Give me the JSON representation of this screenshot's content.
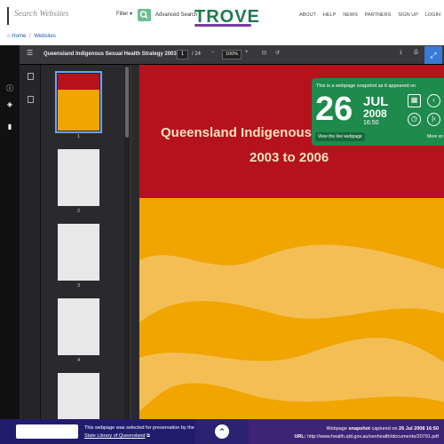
{
  "header": {
    "search_placeholder": "Search Websites",
    "filter_label": "Filter ▾",
    "advanced_search": "Advanced Search",
    "logo": "TROVE",
    "nav": [
      "ABOUT",
      "HELP",
      "NEWS",
      "PARTNERS",
      "SIGN UP",
      "LOGIN"
    ]
  },
  "breadcrumb": {
    "home": "Home",
    "separator": "/",
    "current": "Websites"
  },
  "viewer": {
    "doc_title": "Queensland Indigenous Sexual Health Strategy 2003 ...",
    "page_current": "1",
    "page_total": "/ 24",
    "zoom": "100%",
    "thumbnails": [
      {
        "label": "1"
      },
      {
        "label": "2"
      },
      {
        "label": "3"
      },
      {
        "label": "4"
      }
    ]
  },
  "cover": {
    "title": "Queensland Indigenous Sexu",
    "subtitle": "2003 to 2006"
  },
  "snapshot": {
    "heading": "This is a webpage snapshot as it appeared on",
    "day": "26",
    "month": "JUL",
    "year": "2008",
    "time": "16:50",
    "live_label": "View the live webpage",
    "more_label": "More sn"
  },
  "footer": {
    "selected_text": "This webpage was selected for preservation by the",
    "library_link": "State Library of Queensland",
    "snapshot_prefix": "Webpage",
    "snapshot_bold": "snapshot",
    "snapshot_mid": "captured on",
    "snapshot_date": "26 Jul 2008 16:50",
    "url_label": "URL:",
    "url": "http://www.health.qld.gov.au/sexhealth/documents/20791.pdf"
  },
  "colors": {
    "brand_green": "#1e8a4c",
    "cover_red": "#b5121b",
    "cover_orange": "#f0a500",
    "footer_blue": "#221c6e"
  }
}
